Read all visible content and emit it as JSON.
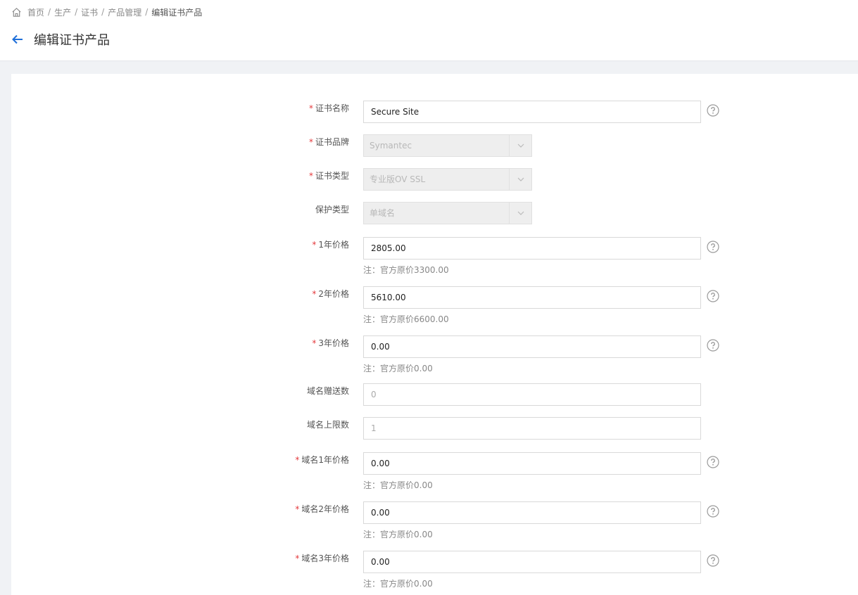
{
  "breadcrumb": {
    "items": [
      "首页",
      "生产",
      "证书",
      "产品管理"
    ],
    "current": "编辑证书产品",
    "separator": "/"
  },
  "page": {
    "title": "编辑证书产品"
  },
  "colors": {
    "required": "#e4393c",
    "back_arrow": "#1e6fd9"
  },
  "form": {
    "cert_name": {
      "label": "证书名称",
      "value": "Secure Site"
    },
    "cert_brand": {
      "label": "证书品牌",
      "value": "Symantec"
    },
    "cert_type": {
      "label": "证书类型",
      "value": "专业版OV SSL"
    },
    "protect_type": {
      "label": "保护类型",
      "value": "单域名"
    },
    "price_1y": {
      "label": "1年价格",
      "value": "2805.00",
      "note": "注：官方原价3300.00"
    },
    "price_2y": {
      "label": "2年价格",
      "value": "5610.00",
      "note": "注：官方原价6600.00"
    },
    "price_3y": {
      "label": "3年价格",
      "value": "0.00",
      "note": "注：官方原价0.00"
    },
    "domain_gift": {
      "label": "域名赠送数",
      "placeholder": "0"
    },
    "domain_limit": {
      "label": "域名上限数",
      "placeholder": "1"
    },
    "domain_price_1y": {
      "label": "域名1年价格",
      "value": "0.00",
      "note": "注：官方原价0.00"
    },
    "domain_price_2y": {
      "label": "域名2年价格",
      "value": "0.00",
      "note": "注：官方原价0.00"
    },
    "domain_price_3y": {
      "label": "域名3年价格",
      "value": "0.00",
      "note": "注：官方原价0.00"
    }
  }
}
